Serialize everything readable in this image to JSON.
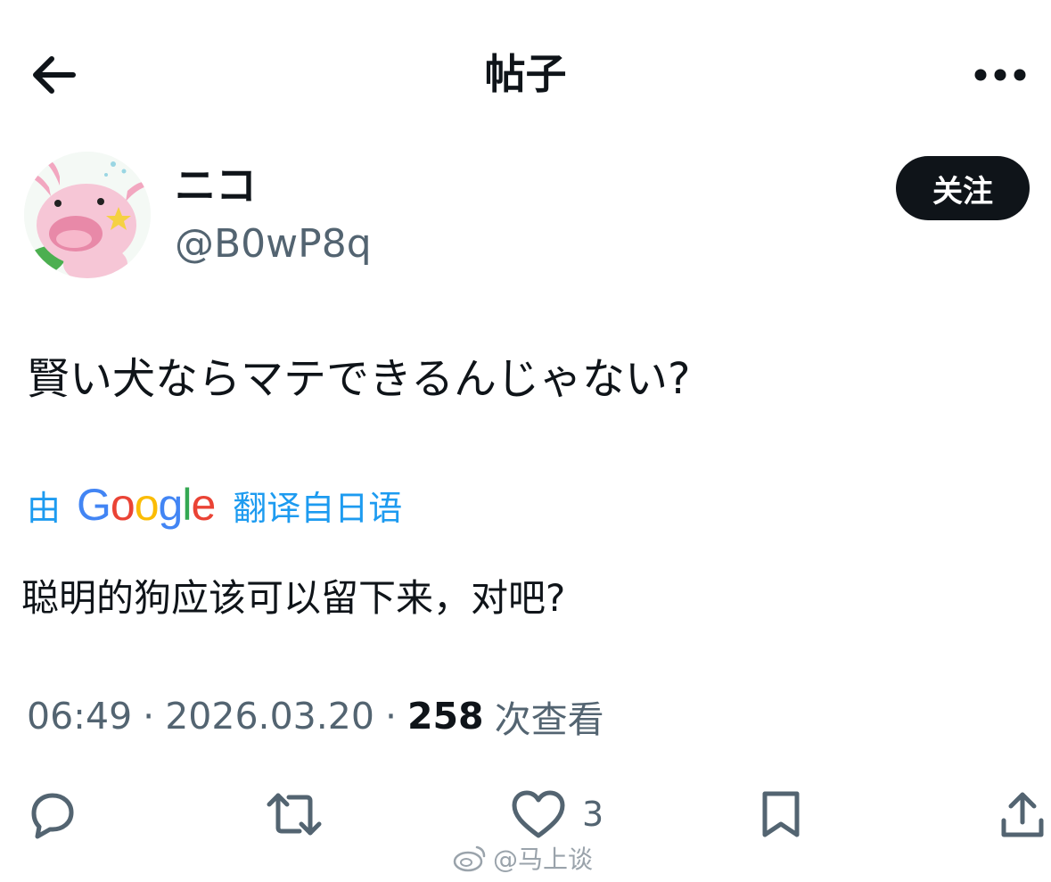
{
  "header": {
    "title": "帖子"
  },
  "author": {
    "display_name": "ニコ",
    "handle": "@B0wP8q",
    "follow_label": "关注"
  },
  "post": {
    "text": "賢い犬ならマテできるんじゃない?",
    "translation": {
      "by_label": "由",
      "provider": "Google",
      "from_label": "翻译自日语",
      "text": "聪明的狗应该可以留下来，对吧?"
    },
    "time": "06:49",
    "date": "2026.03.20",
    "separator": "·",
    "views": "258",
    "views_label": "次查看"
  },
  "actions": {
    "reply_icon": "reply-icon",
    "repost_icon": "repost-icon",
    "like_icon": "heart-icon",
    "like_count": "3",
    "bookmark_icon": "bookmark-icon",
    "share_icon": "share-icon"
  },
  "watermark": {
    "text": "@马上谈"
  },
  "colors": {
    "text_primary": "#0f1419",
    "text_secondary": "#536471",
    "link_blue": "#1d9bf0",
    "google_blue": "#4285F4",
    "google_red": "#EA4335",
    "google_yellow": "#FBBC05",
    "google_green": "#34A853",
    "follow_bg": "#0f1419"
  }
}
